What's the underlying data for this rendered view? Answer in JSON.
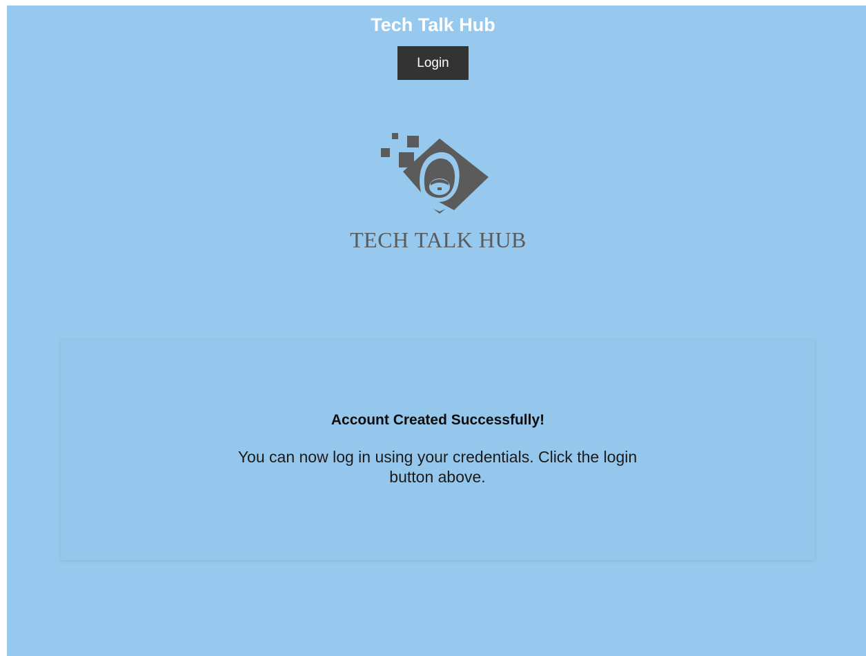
{
  "header": {
    "title": "Tech Talk Hub",
    "login_label": "Login"
  },
  "logo": {
    "text": "TECH TALK HUB",
    "icon": "hooded-figure-diamond-logo",
    "color": "#5b5b5b"
  },
  "message": {
    "heading": "Account Created Successfully!",
    "body": "You can now log in using your credentials. Click the login button above."
  },
  "colors": {
    "background": "#97c9ee",
    "button": "#333333",
    "title": "#ffffff"
  }
}
